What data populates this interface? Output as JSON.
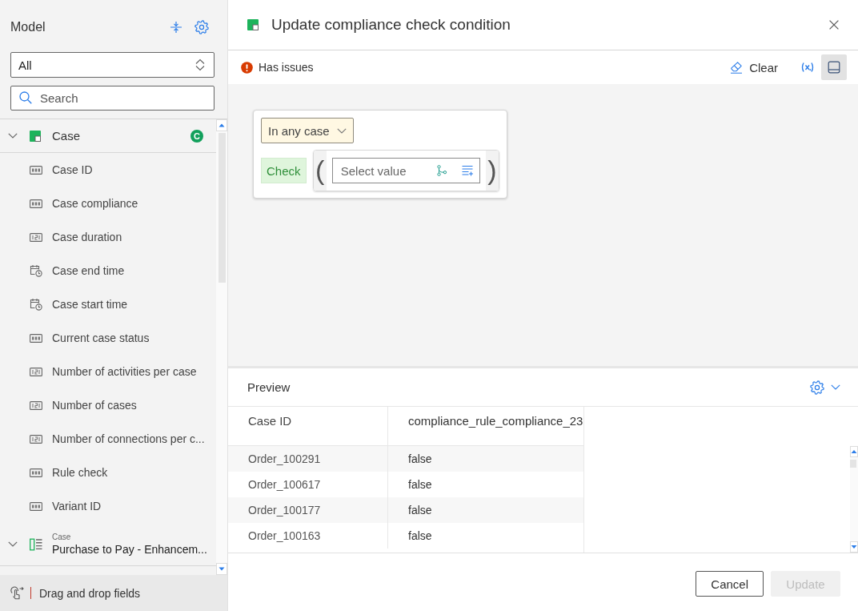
{
  "sidebar": {
    "title": "Model",
    "filter": {
      "value": "All"
    },
    "search": {
      "placeholder": "Search"
    },
    "groups": [
      {
        "kind": "table",
        "label": "Case",
        "expanded": true,
        "badge": "C",
        "items": [
          {
            "label": "Case ID",
            "kind": "text"
          },
          {
            "label": "Case compliance",
            "kind": "text"
          },
          {
            "label": "Case duration",
            "kind": "number"
          },
          {
            "label": "Case end time",
            "kind": "datetime"
          },
          {
            "label": "Case start time",
            "kind": "datetime"
          },
          {
            "label": "Current case status",
            "kind": "text"
          },
          {
            "label": "Number of activities per case",
            "kind": "number"
          },
          {
            "label": "Number of cases",
            "kind": "number"
          },
          {
            "label": "Number of connections per c...",
            "kind": "number"
          },
          {
            "label": "Rule check",
            "kind": "text"
          },
          {
            "label": "Variant ID",
            "kind": "text"
          }
        ]
      },
      {
        "kind": "list",
        "caption": "Case",
        "label": "Purchase to Pay - Enhancem...",
        "expanded": true
      }
    ],
    "hint": "Drag and drop fields"
  },
  "dialog": {
    "title": "Update compliance check condition",
    "status": {
      "kind": "error",
      "text": "Has issues"
    },
    "toolbar": {
      "clear": "Clear",
      "panel_toggle": {
        "selected": true
      }
    },
    "condition": {
      "scope": "In any case",
      "check": "Check",
      "open_bracket": "(",
      "close_bracket": ")",
      "value": {
        "placeholder": "Select value"
      }
    },
    "preview": {
      "title": "Preview",
      "table": {
        "columns": [
          "Case ID",
          "compliance_rule_compliance_23"
        ],
        "rows": [
          [
            "Order_100291",
            "false"
          ],
          [
            "Order_100617",
            "false"
          ],
          [
            "Order_100177",
            "false"
          ],
          [
            "Order_100163",
            "false"
          ]
        ]
      }
    },
    "buttons": [
      {
        "label": "Cancel",
        "disabled": false
      },
      {
        "label": "Update",
        "disabled": true
      }
    ]
  }
}
